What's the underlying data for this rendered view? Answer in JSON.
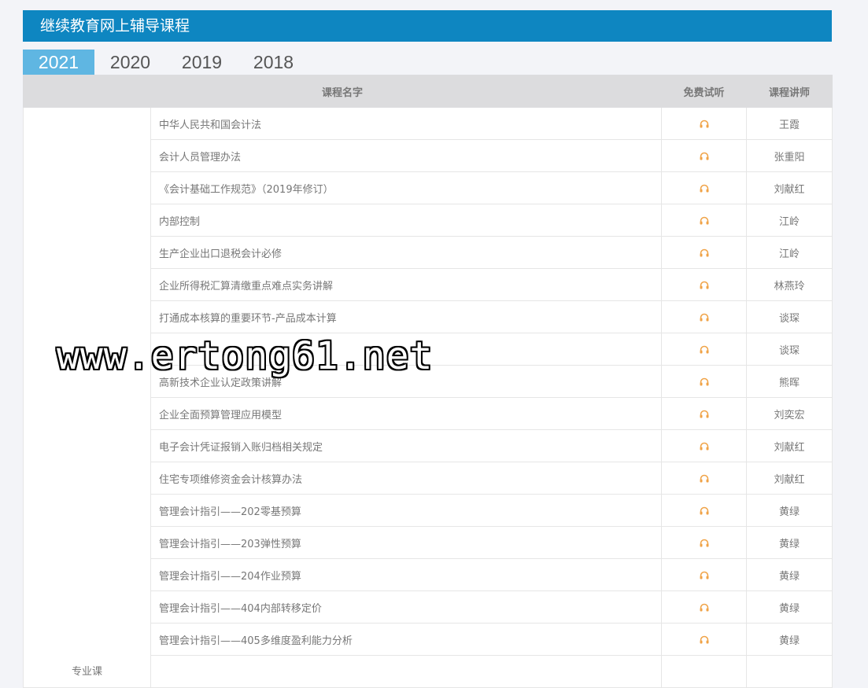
{
  "header": {
    "title": "继续教育网上辅导课程"
  },
  "tabs": [
    {
      "label": "2021",
      "active": true
    },
    {
      "label": "2020",
      "active": false
    },
    {
      "label": "2019",
      "active": false
    },
    {
      "label": "2018",
      "active": false
    }
  ],
  "table": {
    "columns": {
      "course_name": "课程名字",
      "free_trial": "免费试听",
      "teacher": "课程讲师"
    },
    "category": "专业课",
    "icon": "headphone-icon",
    "rows": [
      {
        "course": "中华人民共和国会计法",
        "teacher": "王霞"
      },
      {
        "course": "会计人员管理办法",
        "teacher": "张重阳"
      },
      {
        "course": "《会计基础工作规范》（2019年修订）",
        "teacher": "刘献红"
      },
      {
        "course": "内部控制",
        "teacher": "江岭"
      },
      {
        "course": "生产企业出口退税会计必修",
        "teacher": "江岭"
      },
      {
        "course": "企业所得税汇算清缴重点难点实务讲解",
        "teacher": "林燕玲"
      },
      {
        "course": "打通成本核算的重要环节-产品成本计算",
        "teacher": "谈琛"
      },
      {
        "course": "",
        "teacher": "谈琛"
      },
      {
        "course": "高新技术企业认定政策讲解",
        "teacher": "熊晖"
      },
      {
        "course": "企业全面预算管理应用模型",
        "teacher": "刘奕宏"
      },
      {
        "course": "电子会计凭证报销入账归档相关规定",
        "teacher": "刘献红"
      },
      {
        "course": "住宅专项维修资金会计核算办法",
        "teacher": "刘献红"
      },
      {
        "course": "管理会计指引——202零基预算",
        "teacher": "黄绿"
      },
      {
        "course": "管理会计指引——203弹性预算",
        "teacher": "黄绿"
      },
      {
        "course": "管理会计指引——204作业预算",
        "teacher": "黄绿"
      },
      {
        "course": "管理会计指引——404内部转移定价",
        "teacher": "黄绿"
      },
      {
        "course": "管理会计指引——405多维度盈利能力分析",
        "teacher": "黄绿"
      }
    ]
  },
  "watermark": "www.ertong61.net",
  "colors": {
    "header_bg": "#0e86c1",
    "active_tab": "#5fb6e2",
    "icon": "#f0a347"
  }
}
